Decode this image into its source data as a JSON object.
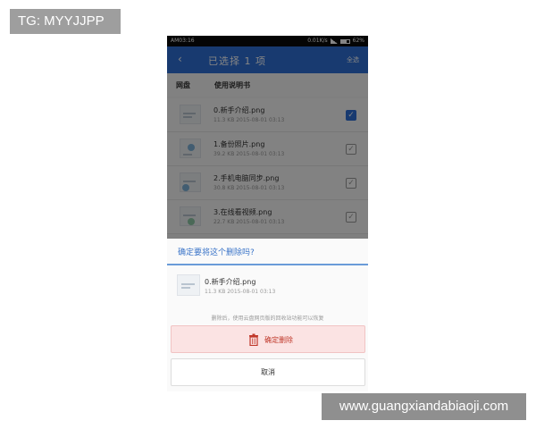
{
  "overlay": {
    "tg_label": "TG: MYYJJPP",
    "watermark": "www.guangxiandabiaoji.com"
  },
  "status_bar": {
    "time": "AM03:16",
    "speed": "0.01K/s",
    "battery": "62%"
  },
  "app_bar": {
    "back_icon": "chevron-left-icon",
    "title": "已选择 1 项",
    "select_all": "全选"
  },
  "list_header": {
    "tab1": "网盘",
    "tab2": "使用说明书"
  },
  "files": [
    {
      "name": "0.新手介绍.png",
      "meta": "11.3 KB   2015-08-01 03:13",
      "checked": true
    },
    {
      "name": "1.备份照片.png",
      "meta": "39.2 KB   2015-08-01 03:13",
      "checked": false
    },
    {
      "name": "2.手机电脑同步.png",
      "meta": "30.8 KB   2015-08-01 03:13",
      "checked": false
    },
    {
      "name": "3.在线看视频.png",
      "meta": "22.7 KB   2015-08-01 03:13",
      "checked": false
    }
  ],
  "dialog": {
    "title": "确定要将这个删除吗?",
    "file_name": "0.新手介绍.png",
    "file_meta": "11.3 KB   2015-08-01 03:13",
    "hint": "删除后，使用云盘网页版的回收站功能可以恢复",
    "confirm_label": "确定删除",
    "cancel_label": "取消",
    "confirm_icon": "trash-icon"
  },
  "colors": {
    "accent": "#2f6fd6",
    "danger": "#c0392b",
    "danger_bg": "#fbe3e3"
  }
}
